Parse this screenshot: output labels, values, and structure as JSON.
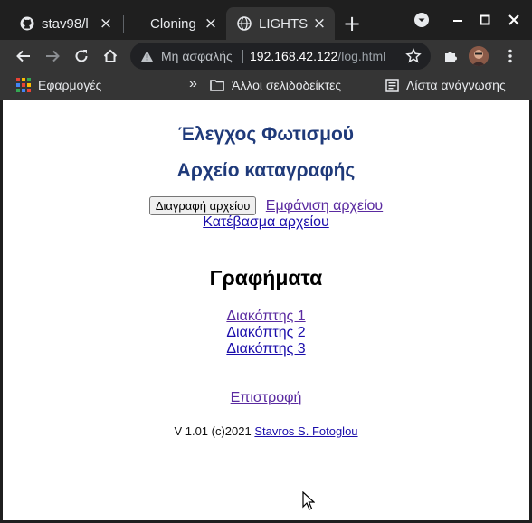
{
  "browser": {
    "tabs": [
      {
        "title": "stav98/l",
        "favicon": "github-icon"
      },
      {
        "title": "Cloning",
        "favicon": "none"
      },
      {
        "title": "LIGHTS",
        "favicon": "globe-icon",
        "active": true
      }
    ],
    "new_tab_label": "+",
    "address_bar": {
      "security_label": "Μη ασφαλής",
      "url_host": "192.168.42.122",
      "url_path": "/log.html"
    },
    "bookmarks": {
      "apps_label": "Εφαρμογές",
      "overflow_label": "»",
      "other_bookmarks_label": "Άλλοι σελιδοδείκτες",
      "reading_list_label": "Λίστα ανάγνωσης"
    }
  },
  "page": {
    "title": "Έλεγχος Φωτισμού",
    "subtitle": "Αρχείο καταγραφής",
    "delete_button_label": "Διαγραφή αρχείου",
    "show_link": "Εμφάνιση αρχείου",
    "download_link": "Κατέβασμα αρχείου",
    "graphs_heading": "Γραφήματα",
    "switch_links": [
      "Διακόπτης 1",
      "Διακόπτης 2",
      "Διακόπτης 3"
    ],
    "back_link": "Επιστροφή",
    "footer_prefix": "V 1.01 (c)2021",
    "footer_author": "Stavros S. Fotoglou"
  },
  "colors": {
    "heading_blue": "#1f3a7a",
    "link_blue": "#1a0dab",
    "link_visited": "#5a2aa0"
  }
}
